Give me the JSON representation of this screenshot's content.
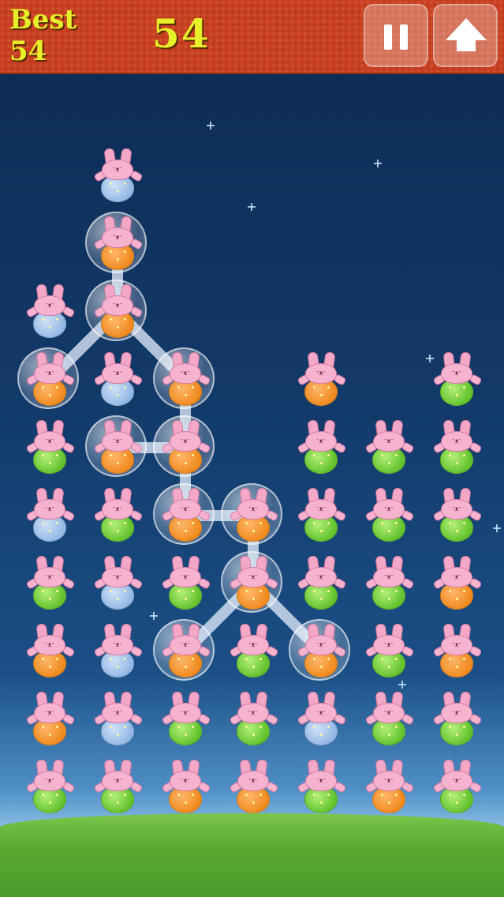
{
  "hud": {
    "best_label": "Best",
    "best_value": "54",
    "score": "54",
    "pause_icon": "pause-icon",
    "up_icon": "up-arrow-icon"
  },
  "colors": {
    "orange": "#f08a1e",
    "green": "#62c22c",
    "blue": "#93b8e6",
    "topbar": "#c8401f",
    "score_text": "#e7ef2a"
  },
  "board": {
    "columns": 7,
    "rows": 10,
    "grid": [
      [
        null,
        "blue",
        null,
        null,
        null,
        null,
        null
      ],
      [
        null,
        "orange",
        null,
        null,
        null,
        null,
        null
      ],
      [
        "blue",
        "orange",
        null,
        null,
        null,
        null,
        null
      ],
      [
        "orange",
        "blue",
        "orange",
        null,
        "orange",
        null,
        "green"
      ],
      [
        "green",
        "orange",
        "orange",
        null,
        "green",
        "green",
        "green"
      ],
      [
        "blue",
        "green",
        "orange",
        "orange",
        "green",
        "green",
        "green"
      ],
      [
        "green",
        "blue",
        "green",
        "orange",
        "green",
        "green",
        "orange"
      ],
      [
        "orange",
        "blue",
        "orange",
        "green",
        "orange",
        "green",
        "orange"
      ],
      [
        "orange",
        "blue",
        "green",
        "green",
        "blue",
        "green",
        "green"
      ],
      [
        "green",
        "green",
        "orange",
        "orange",
        "green",
        "orange",
        "green"
      ]
    ],
    "selected_chain": [
      [
        1,
        1
      ],
      [
        2,
        1
      ],
      [
        3,
        0
      ],
      [
        3,
        2
      ],
      [
        4,
        2
      ],
      [
        4,
        1
      ],
      [
        5,
        2
      ],
      [
        5,
        3
      ],
      [
        6,
        3
      ],
      [
        7,
        2
      ],
      [
        7,
        4
      ]
    ],
    "links": [
      [
        [
          1,
          1
        ],
        [
          2,
          1
        ]
      ],
      [
        [
          2,
          1
        ],
        [
          3,
          0
        ]
      ],
      [
        [
          2,
          1
        ],
        [
          3,
          2
        ]
      ],
      [
        [
          3,
          2
        ],
        [
          4,
          2
        ]
      ],
      [
        [
          4,
          2
        ],
        [
          4,
          1
        ]
      ],
      [
        [
          4,
          2
        ],
        [
          5,
          2
        ]
      ],
      [
        [
          5,
          2
        ],
        [
          5,
          3
        ]
      ],
      [
        [
          5,
          3
        ],
        [
          6,
          3
        ]
      ],
      [
        [
          6,
          3
        ],
        [
          7,
          2
        ]
      ],
      [
        [
          6,
          3
        ],
        [
          7,
          4
        ]
      ]
    ]
  }
}
